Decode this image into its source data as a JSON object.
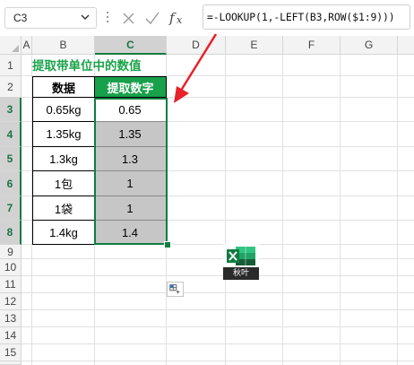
{
  "formula_bar": {
    "name_box": "C3",
    "formula": "=-LOOKUP(1,-LEFT(B3,ROW($1:9)))",
    "cancel_icon": "close-icon",
    "enter_icon": "check-icon",
    "function_icon": "fx-icon"
  },
  "columns": [
    "A",
    "B",
    "C",
    "D",
    "E",
    "F",
    "G"
  ],
  "rows": [
    "1",
    "2",
    "3",
    "4",
    "5",
    "6",
    "7",
    "8",
    "9",
    "10",
    "11",
    "12",
    "13",
    "14",
    "15"
  ],
  "sheet": {
    "title": "提取带单位中的数值",
    "headers": {
      "b": "数据",
      "c": "提取数字"
    },
    "data_rows": [
      {
        "b": "0.65kg",
        "c": "0.65"
      },
      {
        "b": "1.35kg",
        "c": "1.35"
      },
      {
        "b": "1.3kg",
        "c": "1.3"
      },
      {
        "b": "1包",
        "c": "1"
      },
      {
        "b": "1袋",
        "c": "1"
      },
      {
        "b": "1.4kg",
        "c": "1.4"
      }
    ]
  },
  "selected_cell": "C3",
  "logo": {
    "label": "秋叶"
  },
  "colors": {
    "accent_green": "#107c41",
    "title_green": "#1aa34a",
    "header_fill_green": "#18a04b",
    "selected_fill": "#c6c6c6",
    "arrow_red": "#e8202a"
  }
}
